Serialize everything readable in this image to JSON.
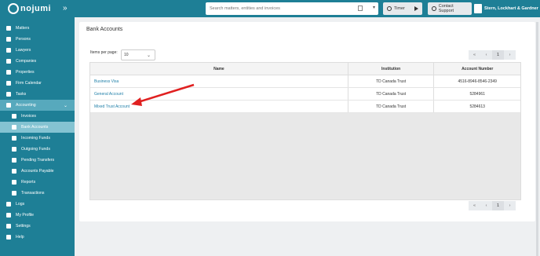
{
  "app": {
    "logo": "nojumi"
  },
  "header": {
    "search_placeholder": "Search matters, entities and invoices",
    "timer_label": "Timer",
    "support_label": "Contact Support",
    "user_name": "Stern, Lockhart & Gardner"
  },
  "sidebar": {
    "items": [
      {
        "label": "Matters",
        "icon": "briefcase-icon"
      },
      {
        "label": "Persons",
        "icon": "people-icon"
      },
      {
        "label": "Lawyers",
        "icon": "person-icon"
      },
      {
        "label": "Companies",
        "icon": "building-icon"
      },
      {
        "label": "Properties",
        "icon": "house-icon"
      },
      {
        "label": "Firm Calendar",
        "icon": "calendar-icon"
      },
      {
        "label": "Tasks",
        "icon": "checkbox-icon"
      },
      {
        "label": "Accounting",
        "icon": "ledger-icon"
      },
      {
        "label": "Invoices",
        "icon": "invoice-icon"
      },
      {
        "label": "Bank Accounts",
        "icon": "bank-icon"
      },
      {
        "label": "Incoming Funds",
        "icon": "arrow-right-icon"
      },
      {
        "label": "Outgoing Funds",
        "icon": "arrow-left-icon"
      },
      {
        "label": "Pending Transfers",
        "icon": "transfer-icon"
      },
      {
        "label": "Accounts Payable",
        "icon": "document-icon"
      },
      {
        "label": "Reports",
        "icon": "report-icon"
      },
      {
        "label": "Transactions",
        "icon": "stack-icon"
      },
      {
        "label": "Logs",
        "icon": "logs-icon"
      },
      {
        "label": "My Profile",
        "icon": "profile-icon"
      },
      {
        "label": "Settings",
        "icon": "gear-icon"
      },
      {
        "label": "Help",
        "icon": "help-icon"
      }
    ]
  },
  "main": {
    "title": "Bank Accounts",
    "items_per_page_label": "Items per page:",
    "items_per_page_value": "10",
    "pager": {
      "first": "«",
      "prev": "‹",
      "page": "1",
      "next": "›"
    },
    "columns": [
      "Name",
      "Institution",
      "Account Number"
    ],
    "rows": [
      {
        "name": "Business Visa",
        "institution": "TD Canada Trust",
        "account": "4516-8946-8546-2349"
      },
      {
        "name": "General Account",
        "institution": "TD Canada Trust",
        "account": "5284961"
      },
      {
        "name": "Mixed Trust Account",
        "institution": "TD Canada Trust",
        "account": "5284613"
      }
    ]
  },
  "colors": {
    "brand": "#1e7f96",
    "active_nav": "#84c3d2",
    "link": "#1f7fa8",
    "annotation_arrow": "#e02020"
  }
}
